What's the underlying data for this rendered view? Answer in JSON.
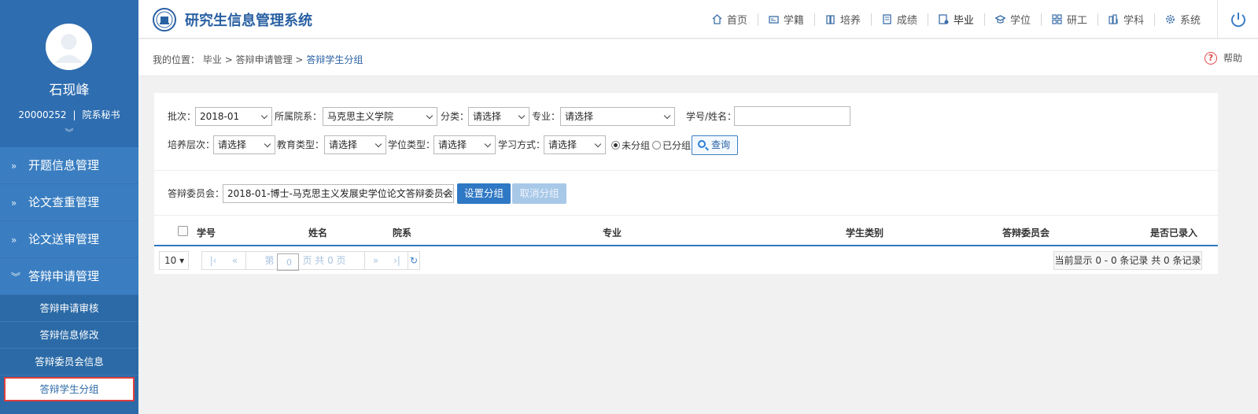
{
  "user": {
    "name": "石现峰",
    "id": "20000252",
    "role": "院系秘书"
  },
  "sidebar": {
    "menus": [
      {
        "label": "开题信息管理",
        "arrow": "»"
      },
      {
        "label": "论文查重管理",
        "arrow": "»"
      },
      {
        "label": "论文送审管理",
        "arrow": "»"
      },
      {
        "label": "答辩申请管理",
        "arrow": "»"
      }
    ],
    "submenu": [
      "答辩申请审核",
      "答辩信息修改",
      "答辩委员会信息",
      "答辩学生分组"
    ]
  },
  "header": {
    "title": "研究生信息管理系统",
    "nav": [
      "首页",
      "学籍",
      "培养",
      "成绩",
      "毕业",
      "学位",
      "研工",
      "学科",
      "系统"
    ]
  },
  "breadcrumb": {
    "prefix": "我的位置：",
    "path1": "毕业",
    "sep": ">",
    "path2": "答辩申请管理",
    "current": "答辩学生分组",
    "help": "帮助"
  },
  "filters": {
    "batch_label": "批次：",
    "batch_value": "2018-01",
    "dept_label": "所属院系：",
    "dept_value": "马克思主义学院",
    "category_label": "分类：",
    "category_value": "请选择",
    "major_label": "专业：",
    "major_value": "请选择",
    "sid_label": "学号/姓名：",
    "level_label": "培养层次：",
    "level_value": "请选择",
    "edu_label": "教育类型：",
    "edu_value": "请选择",
    "degree_label": "学位类型：",
    "degree_value": "请选择",
    "study_label": "学习方式：",
    "study_value": "请选择",
    "radio_ungrouped": "未分组",
    "radio_grouped": "已分组",
    "query": "查询"
  },
  "group": {
    "committee_label": "答辩委员会：",
    "committee_value": "2018-01-博士-马克思主义发展史学位论文答辩委员会",
    "set_btn": "设置分组",
    "cancel_btn": "取消分组"
  },
  "table": {
    "columns": [
      "学号",
      "姓名",
      "院系",
      "专业",
      "学生类别",
      "答辩委员会",
      "是否已录入"
    ]
  },
  "pager": {
    "page_size": "10",
    "page_prefix": "第",
    "page_value": "0",
    "page_suffix": "页 共 0 页",
    "info": "当前显示 0 - 0 条记录 共 0 条记录"
  },
  "colors": {
    "primary": "#2f78c4",
    "sidebar": "#2c6aa8",
    "title": "#2a61a3",
    "active_border": "#e03c3c"
  }
}
